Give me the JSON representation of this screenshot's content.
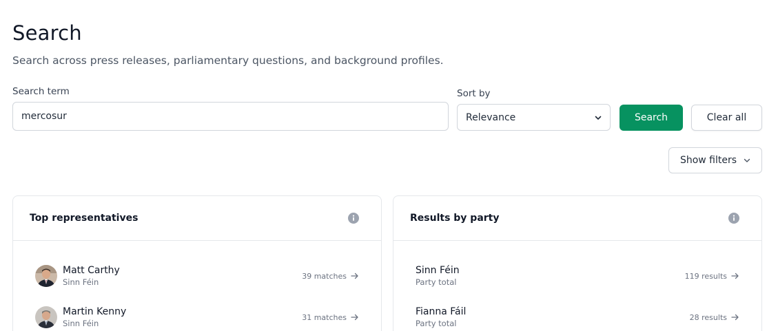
{
  "header": {
    "title": "Search",
    "subtitle": "Search across press releases, parliamentary questions, and background profiles."
  },
  "search": {
    "label": "Search term",
    "value": "mercosur",
    "placeholder": ""
  },
  "sort": {
    "label": "Sort by",
    "selected": "Relevance"
  },
  "buttons": {
    "search": "Search",
    "clear": "Clear all",
    "filters": "Show filters"
  },
  "top_representatives": {
    "title": "Top representatives",
    "items": [
      {
        "name": "Matt Carthy",
        "party": "Sinn Féin",
        "meta": "39 matches"
      },
      {
        "name": "Martin Kenny",
        "party": "Sinn Féin",
        "meta": "31 matches"
      }
    ]
  },
  "results_by_party": {
    "title": "Results by party",
    "items": [
      {
        "name": "Sinn Féin",
        "sub": "Party total",
        "meta": "119 results"
      },
      {
        "name": "Fianna Fáil",
        "sub": "Party total",
        "meta": "28 results"
      }
    ]
  },
  "colors": {
    "accent": "#079260",
    "info_icon": "#9ca3af"
  }
}
